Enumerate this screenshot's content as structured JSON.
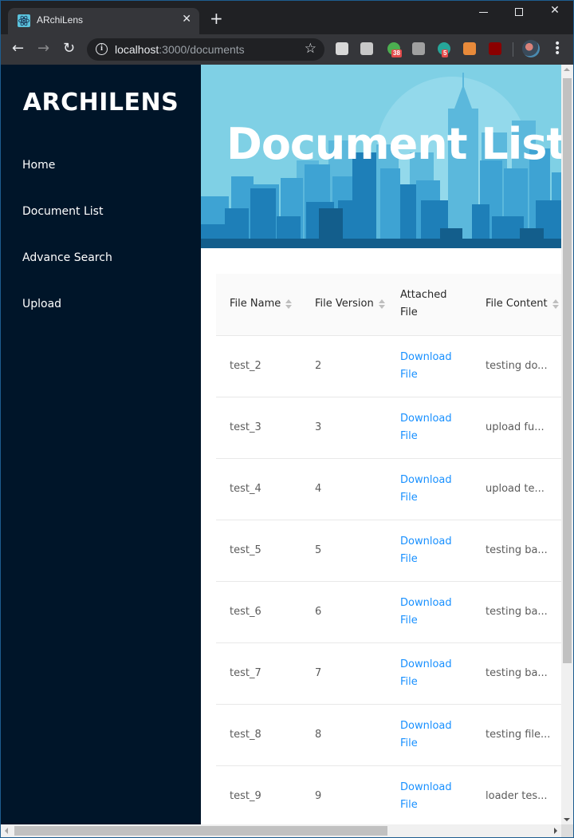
{
  "browser": {
    "tab_title": "ARchiLens",
    "tab_close": "✕",
    "new_tab": "+",
    "url_host": "localhost",
    "url_rest": ":3000/documents",
    "info": "i",
    "star": "☆",
    "back": "←",
    "forward": "→",
    "reload": "↻",
    "extensions": [
      {
        "name": "toby-extension-icon",
        "color": "#d8d8d8",
        "badge": ""
      },
      {
        "name": "chrome-remote-icon",
        "color": "#c8c8c8",
        "badge": ""
      },
      {
        "name": "pushbullet-icon",
        "color": "#4caf50",
        "badge": "38"
      },
      {
        "name": "keepa-icon",
        "color": "#a0a0a0",
        "badge": ""
      },
      {
        "name": "anki-icon",
        "color": "#26a69a",
        "badge": "5"
      },
      {
        "name": "metamask-icon",
        "color": "#e88a3a",
        "badge": ""
      },
      {
        "name": "ublock-origin-icon",
        "color": "#8b0000",
        "badge": ""
      }
    ],
    "menu": "⋮"
  },
  "sidebar": {
    "logo": "ARCHILENS",
    "items": [
      {
        "label": "Home"
      },
      {
        "label": "Document List"
      },
      {
        "label": "Advance Search"
      },
      {
        "label": "Upload"
      }
    ]
  },
  "banner": {
    "title": "Document List"
  },
  "table": {
    "columns": [
      {
        "label": "File Name",
        "sortable": true
      },
      {
        "label": "File Version",
        "sortable": true
      },
      {
        "label": "Attached File",
        "sortable": false
      },
      {
        "label": "File Content",
        "sortable": true
      }
    ],
    "rows": [
      {
        "name": "test_2",
        "version": "2",
        "link": "Download File",
        "content": "testing do..."
      },
      {
        "name": "test_3",
        "version": "3",
        "link": "Download File",
        "content": "upload fu..."
      },
      {
        "name": "test_4",
        "version": "4",
        "link": "Download File",
        "content": "upload te..."
      },
      {
        "name": "test_5",
        "version": "5",
        "link": "Download File",
        "content": "testing ba..."
      },
      {
        "name": "test_6",
        "version": "6",
        "link": "Download File",
        "content": "testing ba..."
      },
      {
        "name": "test_7",
        "version": "7",
        "link": "Download File",
        "content": "testing ba..."
      },
      {
        "name": "test_8",
        "version": "8",
        "link": "Download File",
        "content": "testing file..."
      },
      {
        "name": "test_9",
        "version": "9",
        "link": "Download File",
        "content": "loader tes..."
      }
    ]
  }
}
